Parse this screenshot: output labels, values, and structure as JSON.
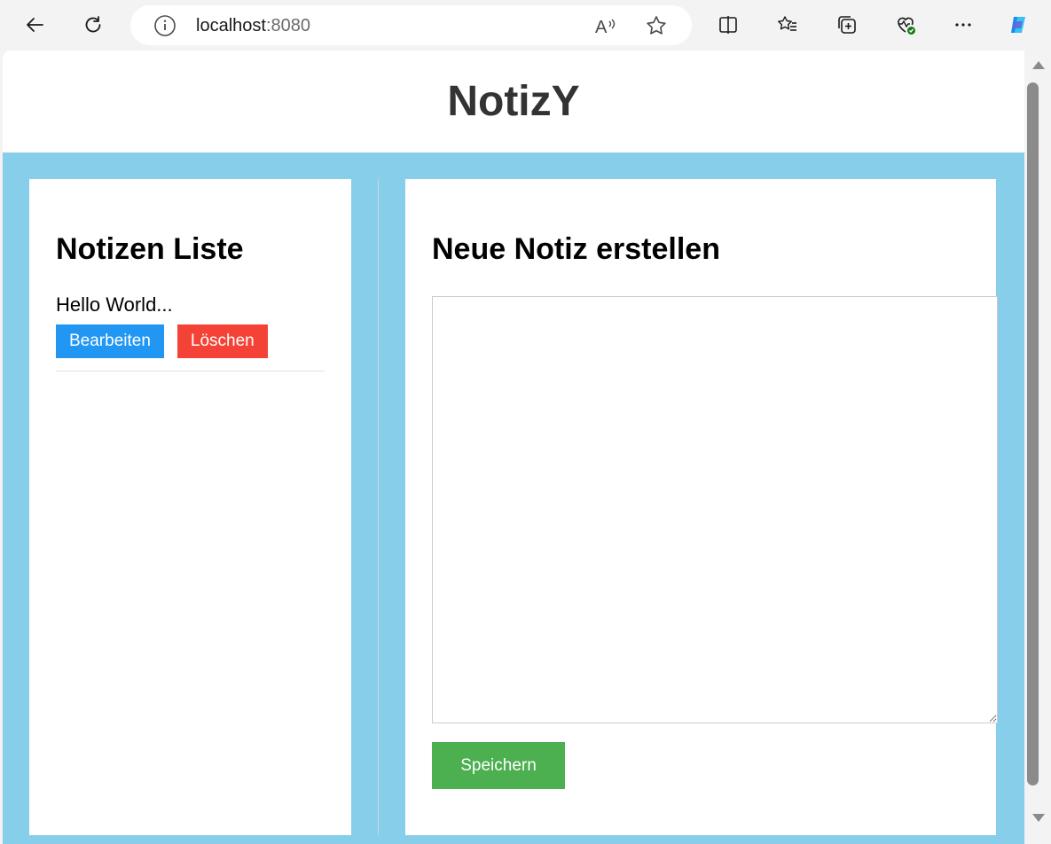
{
  "browser": {
    "url_host": "localhost",
    "url_port": ":8080",
    "icons": [
      "back-arrow-icon",
      "refresh-icon",
      "info-icon",
      "read-aloud-icon",
      "favorite-star-icon",
      "split-screen-icon",
      "favorites-icon",
      "collections-icon",
      "browser-essentials-icon",
      "more-icon",
      "copilot-icon"
    ]
  },
  "app": {
    "title": "NotizY"
  },
  "notes_list": {
    "heading": "Notizen Liste",
    "items": [
      {
        "text": "Hello World...",
        "edit_label": "Bearbeiten",
        "delete_label": "Löschen"
      }
    ]
  },
  "new_note": {
    "heading": "Neue Notiz erstellen",
    "textarea_value": "",
    "save_label": "Speichern"
  },
  "colors": {
    "background": "#87ceeb",
    "edit": "#2196f3",
    "delete": "#f44336",
    "save": "#4caf50",
    "title": "#333333"
  }
}
